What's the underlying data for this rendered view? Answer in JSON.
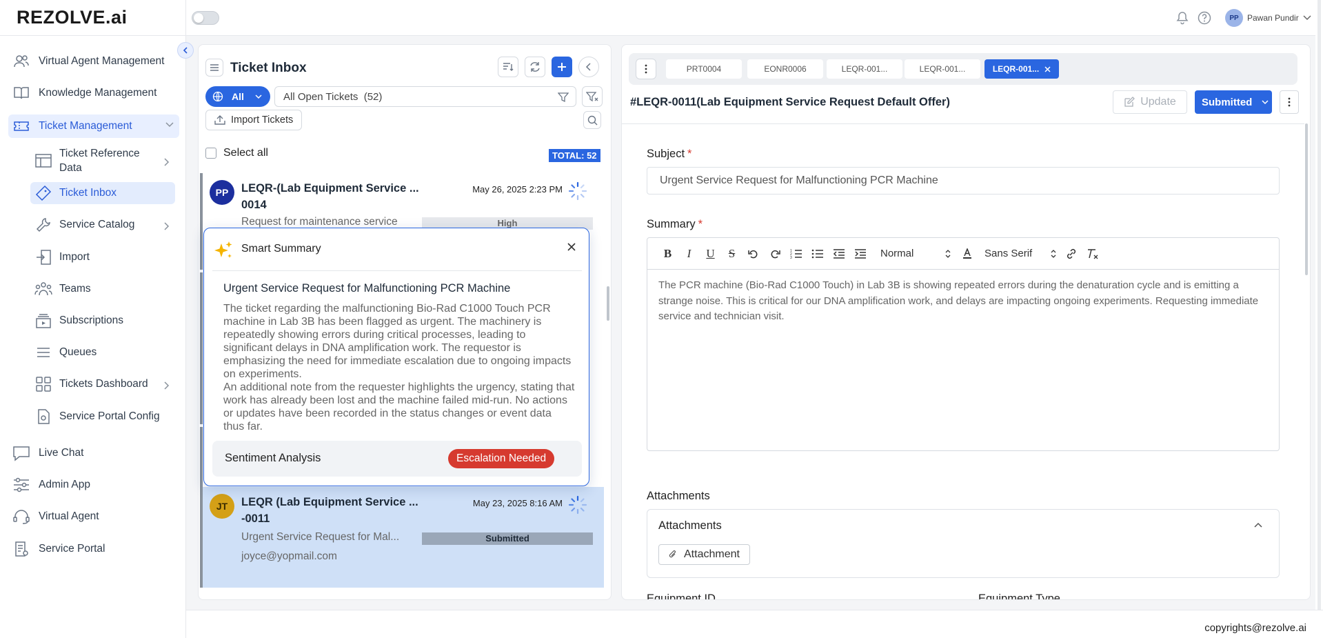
{
  "app": {
    "logo": "REZOLVE.ai",
    "user_initials": "PP",
    "user_name": "Pawan Pundir"
  },
  "sidebar": {
    "items": [
      {
        "label": "Virtual Agent Management",
        "icon": "users-icon"
      },
      {
        "label": "Knowledge Management",
        "icon": "book-icon"
      },
      {
        "label": "Ticket Management",
        "icon": "ticket-icon"
      },
      {
        "label": "Live Chat",
        "icon": "chat-icon"
      },
      {
        "label": "Admin App",
        "icon": "sliders-icon"
      },
      {
        "label": "Virtual Agent",
        "icon": "headset-icon"
      },
      {
        "label": "Service Portal",
        "icon": "portal-icon"
      }
    ],
    "sub_items": [
      {
        "label": "Ticket Reference Data",
        "icon": "table-icon"
      },
      {
        "label": "Ticket Inbox",
        "icon": "ticket-icon"
      },
      {
        "label": "Service Catalog",
        "icon": "wrench-icon"
      },
      {
        "label": "Import",
        "icon": "import-icon"
      },
      {
        "label": "Teams",
        "icon": "team-icon"
      },
      {
        "label": "Subscriptions",
        "icon": "subscription-icon"
      },
      {
        "label": "Queues",
        "icon": "queue-icon"
      },
      {
        "label": "Tickets Dashboard",
        "icon": "dashboard-icon"
      },
      {
        "label": "Service Portal Config",
        "icon": "config-icon"
      }
    ]
  },
  "inbox": {
    "title": "Ticket Inbox",
    "scope": "All",
    "filter_label": "All Open Tickets  (52)",
    "import_label": "Import Tickets",
    "select_all": "Select all",
    "total": "TOTAL: 52",
    "tickets": [
      {
        "initials": "PP",
        "avatar_color": "#1c2f9e",
        "title": "LEQR-(Lab Equipment Service ... 0014",
        "date": "May 26, 2025 2:23 PM",
        "desc": "Request for maintenance service",
        "badge": "High"
      },
      {
        "initials": "JT",
        "avatar_color": "#d4a017",
        "title": "LEQR (Lab Equipment Service ... -0011",
        "date": "May 23, 2025 8:16 AM",
        "desc": "Urgent Service Request for Mal...",
        "badge": "Submitted",
        "email": "joyce@yopmail.com"
      }
    ]
  },
  "smart_summary": {
    "title": "Smart Summary",
    "heading": "Urgent Service Request for Malfunctioning PCR Machine",
    "paragraph1": "The ticket regarding the malfunctioning Bio-Rad C1000 Touch PCR machine in Lab 3B has been flagged as urgent. The machinery is repeatedly showing errors during critical processes, leading to significant delays in DNA amplification work. The requestor is emphasizing the need for immediate escalation due to ongoing impacts on experiments.",
    "paragraph2": "An additional note from the requester highlights the urgency, stating that work has already been lost and the machine failed mid-run. No actions or updates have been recorded in the status changes or event data thus far.",
    "sentiment_label": "Sentiment Analysis",
    "sentiment_value": "Escalation Needed"
  },
  "detail": {
    "tabs": [
      "PRT0004",
      "EONR0006",
      "LEQR-001...",
      "LEQR-001...",
      "LEQR-001..."
    ],
    "title": "#LEQR-0011(Lab Equipment Service Request Default Offer)",
    "update_label": "Update",
    "status_label": "Submitted",
    "subject_label": "Subject",
    "subject_value": "Urgent Service Request for Malfunctioning PCR Machine",
    "summary_label": "Summary",
    "editor_heading": "Normal",
    "editor_font": "Sans Serif",
    "summary_text": "The PCR machine (Bio-Rad C1000 Touch) in Lab 3B is showing repeated errors during the denaturation cycle and is emitting a strange noise. This is critical for our DNA amplification work, and delays are impacting ongoing experiments. Requesting immediate service and technician visit.",
    "attachments_section": "Attachments",
    "attachments_title": "Attachments",
    "attachment_button": "Attachment",
    "equipment_id_label": "Equipment ID",
    "equipment_type_label": "Equipment Type"
  },
  "footer": {
    "copyright": "copyrights@rezolve.ai"
  },
  "colors": {
    "accent": "#2a66e0",
    "danger": "#d63a2f",
    "selected_row": "#cfe0f7"
  }
}
